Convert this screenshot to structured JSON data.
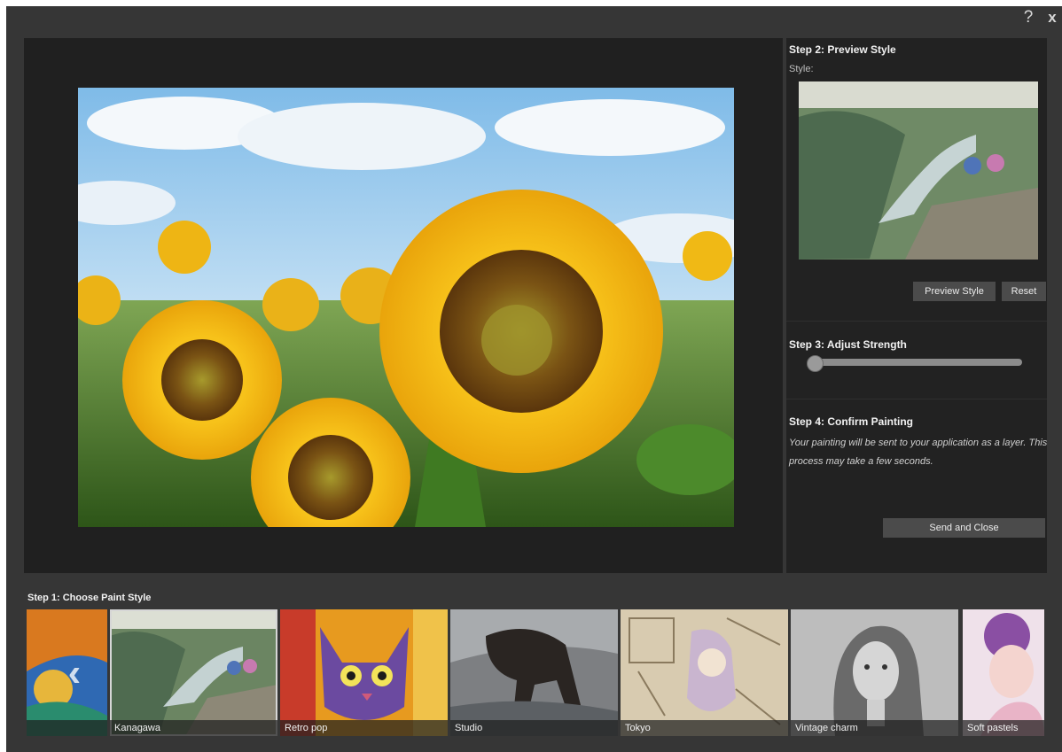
{
  "titlebar": {
    "help_label": "?",
    "close_label": "x"
  },
  "side": {
    "step2_title": "Step 2: Preview Style",
    "style_label": "Style:",
    "preview_button": "Preview Style",
    "reset_button": "Reset",
    "step3_title": "Step 3: Adjust Strength",
    "strength_value": 0,
    "step4_title": "Step 4: Confirm Painting",
    "step4_desc": "Your painting will be sent to your application as a layer. This process may take a few seconds.",
    "send_button": "Send and Close"
  },
  "strip": {
    "title": "Step 1: Choose Paint Style",
    "scroll_left_label": "‹",
    "styles": [
      {
        "label": ""
      },
      {
        "label": "Kanagawa",
        "selected": true
      },
      {
        "label": "Retro pop"
      },
      {
        "label": "Studio"
      },
      {
        "label": "Tokyo"
      },
      {
        "label": "Vintage charm"
      },
      {
        "label": "Soft pastels"
      }
    ]
  },
  "colors": {
    "window_bg": "#363636",
    "panel_bg": "#222222",
    "button_bg": "#4b4b4b"
  }
}
